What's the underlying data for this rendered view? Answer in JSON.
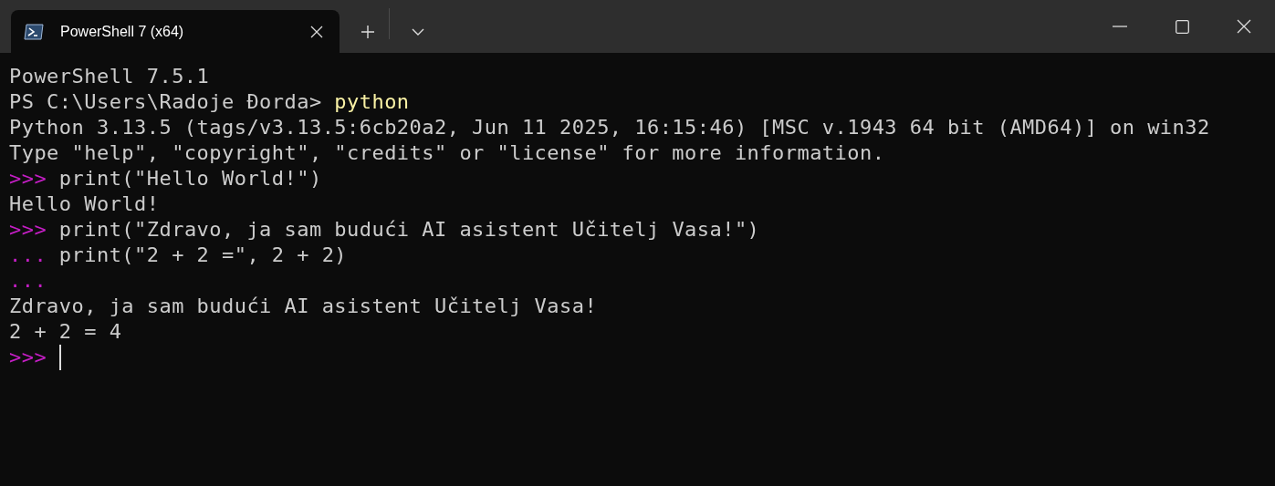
{
  "tabs": [
    {
      "title": "PowerShell 7 (x64)",
      "selected": true
    }
  ],
  "terminal": {
    "lines": [
      {
        "segments": [
          {
            "kind": "output",
            "text": "PowerShell 7.5.1"
          }
        ]
      },
      {
        "segments": [
          {
            "kind": "output",
            "text": "PS C:\\Users\\Radoje Đorda> "
          },
          {
            "kind": "command",
            "text": "python"
          }
        ]
      },
      {
        "segments": [
          {
            "kind": "output",
            "text": "Python 3.13.5 (tags/v3.13.5:6cb20a2, Jun 11 2025, 16:15:46) [MSC v.1943 64 bit (AMD64)] on win32"
          }
        ]
      },
      {
        "segments": [
          {
            "kind": "output",
            "text": "Type \"help\", \"copyright\", \"credits\" or \"license\" for more information."
          }
        ]
      },
      {
        "segments": [
          {
            "kind": "prompt",
            "text": ">>>"
          },
          {
            "kind": "output",
            "text": " print(\"Hello World!\")"
          }
        ]
      },
      {
        "segments": [
          {
            "kind": "output",
            "text": "Hello World!"
          }
        ]
      },
      {
        "segments": [
          {
            "kind": "prompt",
            "text": ">>>"
          },
          {
            "kind": "output",
            "text": " print(\"Zdravo, ja sam budući AI asistent Učitelj Vasa!\")"
          }
        ]
      },
      {
        "segments": [
          {
            "kind": "prompt",
            "text": "..."
          },
          {
            "kind": "output",
            "text": " print(\"2 + 2 =\", 2 + 2)"
          }
        ]
      },
      {
        "segments": [
          {
            "kind": "prompt",
            "text": "..."
          }
        ]
      },
      {
        "segments": [
          {
            "kind": "output",
            "text": "Zdravo, ja sam budući AI asistent Učitelj Vasa!"
          }
        ]
      },
      {
        "segments": [
          {
            "kind": "output",
            "text": "2 + 2 = 4"
          }
        ]
      },
      {
        "segments": [
          {
            "kind": "prompt",
            "text": ">>>"
          }
        ],
        "cursor": true
      }
    ]
  }
}
